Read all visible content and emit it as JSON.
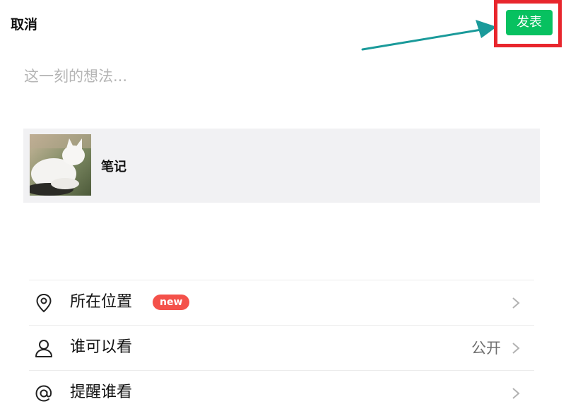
{
  "header": {
    "cancel_label": "取消",
    "publish_label": "发表",
    "publish_color": "#07c160",
    "highlight_color": "#e8262d",
    "arrow_color": "#1a9a9a"
  },
  "composer": {
    "placeholder": "这一刻的想法..."
  },
  "share_card": {
    "title": "笔记",
    "thumbnail": "white-cat-photo"
  },
  "options": [
    {
      "icon": "location-pin-icon",
      "label": "所在位置",
      "badge": "new",
      "value": ""
    },
    {
      "icon": "person-icon",
      "label": "谁可以看",
      "badge": "",
      "value": "公开"
    },
    {
      "icon": "at-sign-icon",
      "label": "提醒谁看",
      "badge": "",
      "value": ""
    }
  ]
}
